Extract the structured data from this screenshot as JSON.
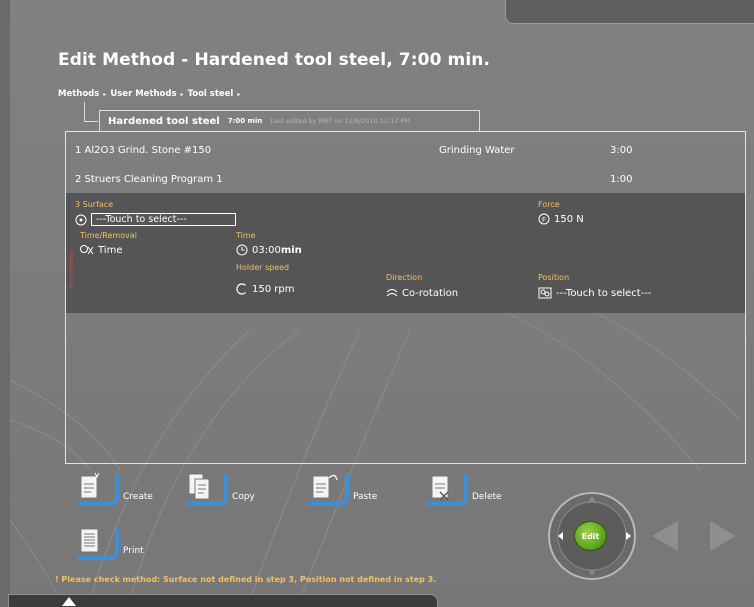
{
  "page": {
    "title": "Edit Method - Hardened tool steel, 7:00 min."
  },
  "breadcrumb": {
    "items": [
      "Methods",
      "User Methods",
      "Tool steel"
    ],
    "separator": "▸"
  },
  "method": {
    "name": "Hardened tool steel",
    "time": "7:00 min",
    "edited": "Last edited by MRT on 12/8/2010 12:17 PM"
  },
  "steps": [
    {
      "label": "1  Al2O3 Grind. Stone #150",
      "medium": "Grinding Water",
      "duration": "3:00"
    },
    {
      "label": "2  Struers Cleaning Program 1",
      "medium": "",
      "duration": "1:00"
    }
  ],
  "step3": {
    "surface_label": "3  Surface",
    "surface_value": "---Touch to select---",
    "process_label": "Fine Grinding",
    "force_label": "Force",
    "force_value": "150 N",
    "time_removal_label": "Time/Removal",
    "time_removal_value": "Time",
    "time_label": "Time",
    "time_value": "03:00",
    "time_unit": "min",
    "holder_speed_label": "Holder speed",
    "holder_speed_value": "150 rpm",
    "direction_label": "Direction",
    "direction_value": "Co-rotation",
    "position_label": "Position",
    "position_value": "---Touch to select---"
  },
  "toolbar": {
    "create_label": "Create",
    "copy_label": "Copy",
    "paste_label": "Paste",
    "delete_label": "Delete",
    "print_label": "Print"
  },
  "nav": {
    "edit_label": "Edit"
  },
  "warning": "! Please check method: Surface not defined in step 3, Position not defined in step 3.",
  "colors": {
    "background": "#7d7d7d",
    "step_highlight": "#555555",
    "label_accent": "#f2c060",
    "button_blue": "#3d8fd6",
    "edit_green": "#58a018"
  }
}
